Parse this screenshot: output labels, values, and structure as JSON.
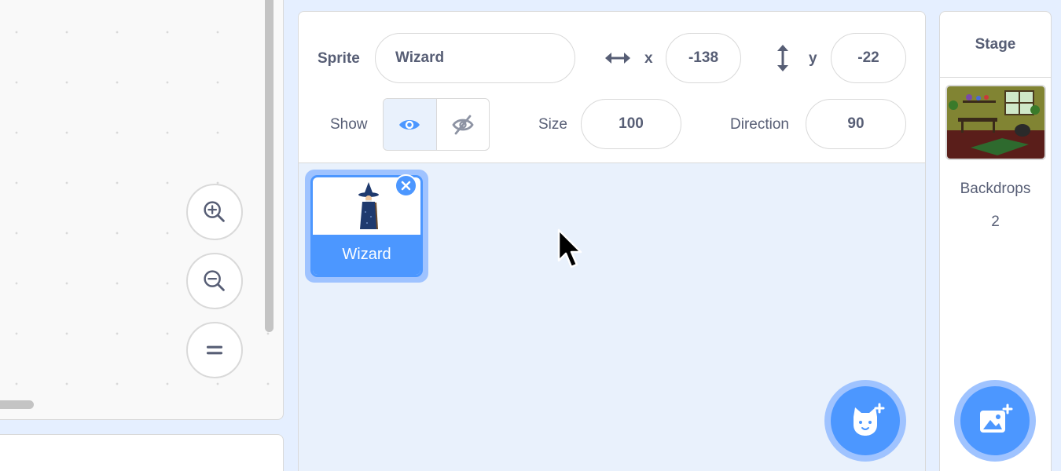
{
  "code_area": {
    "zoom_in_label": "Zoom in",
    "zoom_out_label": "Zoom out",
    "reset_zoom_label": "Reset zoom"
  },
  "sprite_info": {
    "sprite_label": "Sprite",
    "sprite_name": "Wizard",
    "x_label": "x",
    "x_value": "-138",
    "y_label": "y",
    "y_value": "-22",
    "show_label": "Show",
    "size_label": "Size",
    "size_value": "100",
    "direction_label": "Direction",
    "direction_value": "90",
    "show_visible": true
  },
  "sprite_list": {
    "items": [
      {
        "name": "Wizard",
        "selected": true
      }
    ]
  },
  "stage": {
    "header": "Stage",
    "backdrops_label": "Backdrops",
    "backdrops_count": "2"
  },
  "colors": {
    "accent": "#4c97ff",
    "accent_halo": "#9fc3ff",
    "text": "#575e75",
    "pane_bg": "#e9f1fc"
  },
  "icons": [
    "zoom-in-icon",
    "zoom-out-icon",
    "reset-zoom-icon",
    "horizontal-arrows-icon",
    "vertical-arrows-icon",
    "eye-icon",
    "eye-hidden-icon",
    "close-icon",
    "choose-sprite-icon",
    "choose-backdrop-icon",
    "mouse-cursor-icon"
  ]
}
